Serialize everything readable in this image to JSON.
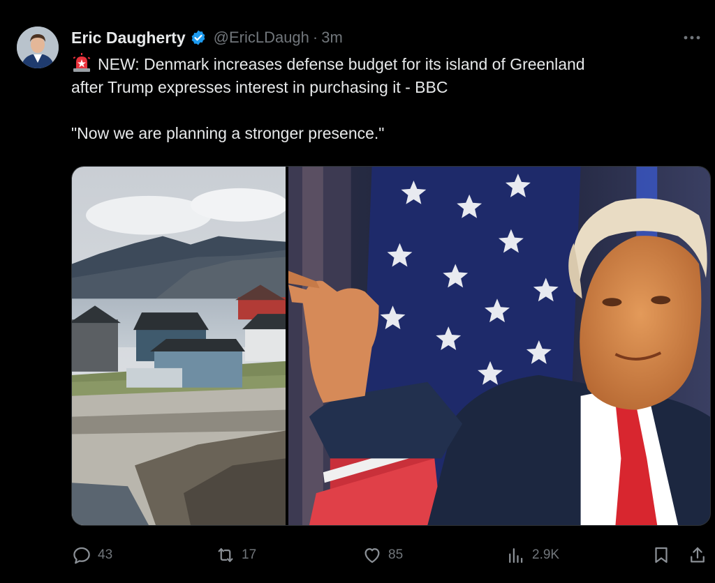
{
  "post": {
    "author": {
      "display_name": "Eric Daugherty",
      "handle": "@EricLDaugh",
      "separator": "·",
      "time": "3m",
      "verified_color": "#1d9bf0"
    },
    "text": {
      "line1": "NEW: Denmark increases defense budget for its island of Greenland",
      "line2": "after Trump expresses interest in purchasing it - BBC",
      "line3": "\"Now we are planning a stronger presence.\""
    },
    "icons": {
      "prefix_emoji": "rotating-light-icon",
      "more": "more-icon"
    },
    "metrics": {
      "replies": "43",
      "reposts": "17",
      "likes": "85",
      "views": "2.9K"
    },
    "colors": {
      "background": "#000000",
      "text": "#e7e9ea",
      "muted": "#71767b",
      "accent": "#1d9bf0"
    }
  }
}
